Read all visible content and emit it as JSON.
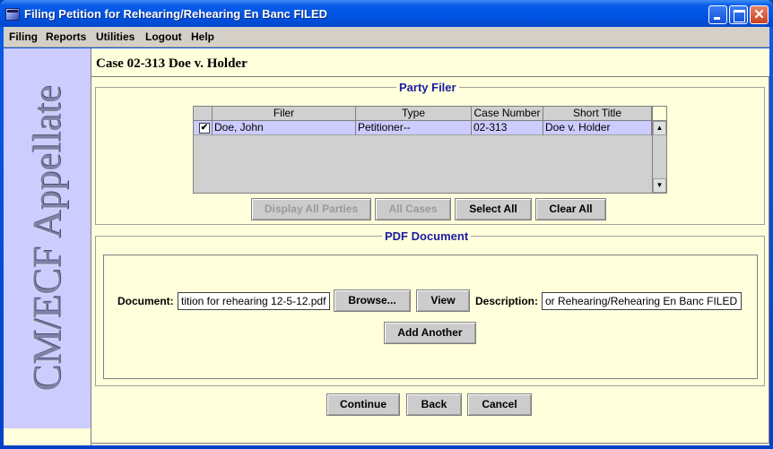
{
  "window": {
    "title": "Filing Petition for Rehearing/Rehearing En Banc FILED",
    "close_glyph": "✕"
  },
  "menu": {
    "items": [
      {
        "label": "Filing"
      },
      {
        "label": "Reports"
      },
      {
        "label": "Utilities"
      },
      {
        "label": "Logout"
      },
      {
        "label": "Help"
      }
    ]
  },
  "sidebar": {
    "brand": "CM/ECF Appellate"
  },
  "case": {
    "title": "Case 02-313 Doe v. Holder"
  },
  "party_filer": {
    "group_title": "Party Filer",
    "columns": [
      "",
      "Filer",
      "Type",
      "Case Number",
      "Short Title"
    ],
    "rows": [
      {
        "checked": true,
        "check_glyph": "✔",
        "filer": "Doe, John",
        "type": "Petitioner--",
        "case_number": "02-313",
        "short_title": "Doe v. Holder"
      }
    ],
    "scroll_up_glyph": "▲",
    "scroll_down_glyph": "▼",
    "buttons": {
      "display_all_parties": "Display All Parties",
      "all_cases": "All Cases",
      "select_all": "Select All",
      "clear_all": "Clear All"
    }
  },
  "pdf_document": {
    "group_title": "PDF Document",
    "document_label": "Document:",
    "document_value": "tition for rehearing 12-5-12.pdf",
    "browse_label": "Browse...",
    "view_label": "View",
    "description_label": "Description:",
    "description_value": "or Rehearing/Rehearing En Banc FILED",
    "add_another_label": "Add Another"
  },
  "footer": {
    "continue_label": "Continue",
    "back_label": "Back",
    "cancel_label": "Cancel"
  }
}
